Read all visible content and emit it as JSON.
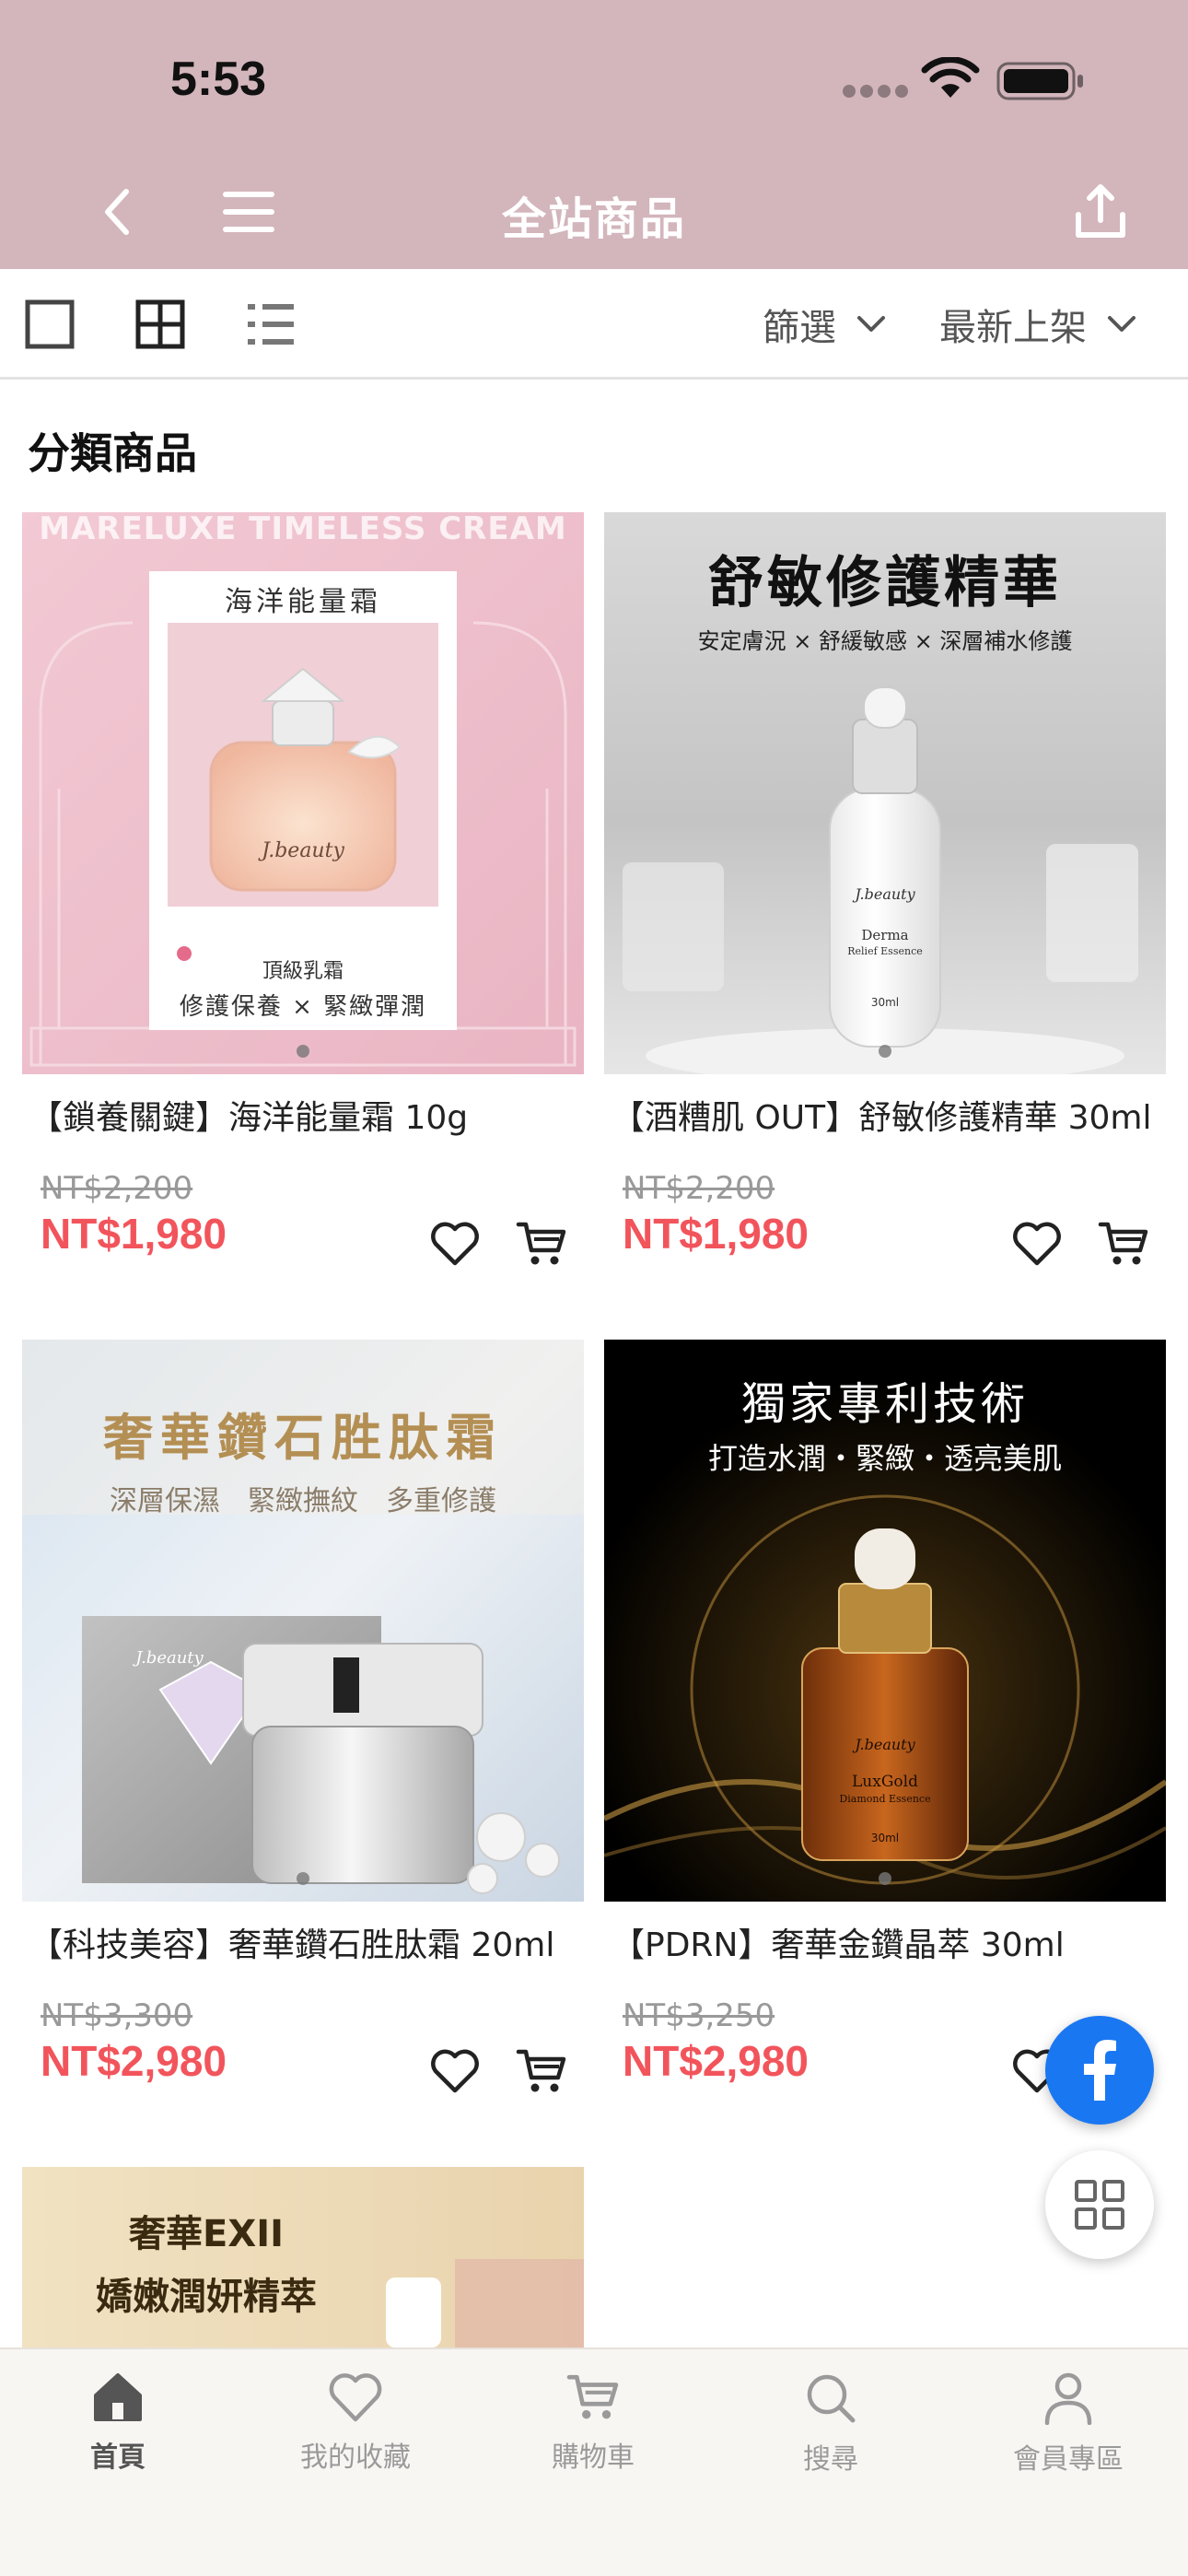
{
  "status": {
    "time": "5:53"
  },
  "nav": {
    "title": "全站商品"
  },
  "toolbar": {
    "filter_label": "篩選",
    "sort_label": "最新上架"
  },
  "section": {
    "title": "分類商品"
  },
  "products": [
    {
      "name": "【鎖養關鍵】海洋能量霜 10g",
      "old_price": "NT$2,200",
      "price": "NT$1,980",
      "img": {
        "heading": "海洋能量霜",
        "banner": "MARELUXE TIMELESS CREAM",
        "brand": "J.beauty",
        "sub": "頂級乳霜",
        "tagline": "修護保養 × 緊緻彈潤"
      }
    },
    {
      "name": "【酒糟肌 OUT】舒敏修護精華 30ml",
      "old_price": "NT$2,200",
      "price": "NT$1,980",
      "img": {
        "heading": "舒敏修護精華",
        "sub": "安定膚況 × 舒緩敏感 × 深層補水修護",
        "brand": "J.beauty",
        "label1": "Derma",
        "label2": "Relief Essence",
        "label3": "30ml"
      }
    },
    {
      "name": "【科技美容】奢華鑽石胜肽霜 20ml",
      "old_price": "NT$3,300",
      "price": "NT$2,980",
      "img": {
        "heading": "奢華鑽石胜肽霜",
        "sub": "深層保濕　緊緻撫紋　多重修護",
        "brand": "J.beauty"
      }
    },
    {
      "name": "【PDRN】奢華金鑽晶萃 30ml",
      "old_price": "NT$3,250",
      "price": "NT$2,980",
      "img": {
        "heading": "獨家專利技術",
        "sub": "打造水潤・緊緻・透亮美肌",
        "brand": "J.beauty",
        "label1": "LuxGold",
        "label2": "Diamond Essence",
        "label3": "30ml"
      }
    },
    {
      "img": {
        "line1": "奢華EXII",
        "line2": "嬌嫩潤妍精萃"
      }
    }
  ],
  "tabs": [
    {
      "label": "首頁",
      "icon": "home-icon"
    },
    {
      "label": "我的收藏",
      "icon": "heart-icon"
    },
    {
      "label": "購物車",
      "icon": "cart-icon"
    },
    {
      "label": "搜尋",
      "icon": "search-icon"
    },
    {
      "label": "會員專區",
      "icon": "user-icon"
    }
  ],
  "colors": {
    "header": "#d3b5bc",
    "price": "#f2545b",
    "facebook": "#1a77f2"
  }
}
